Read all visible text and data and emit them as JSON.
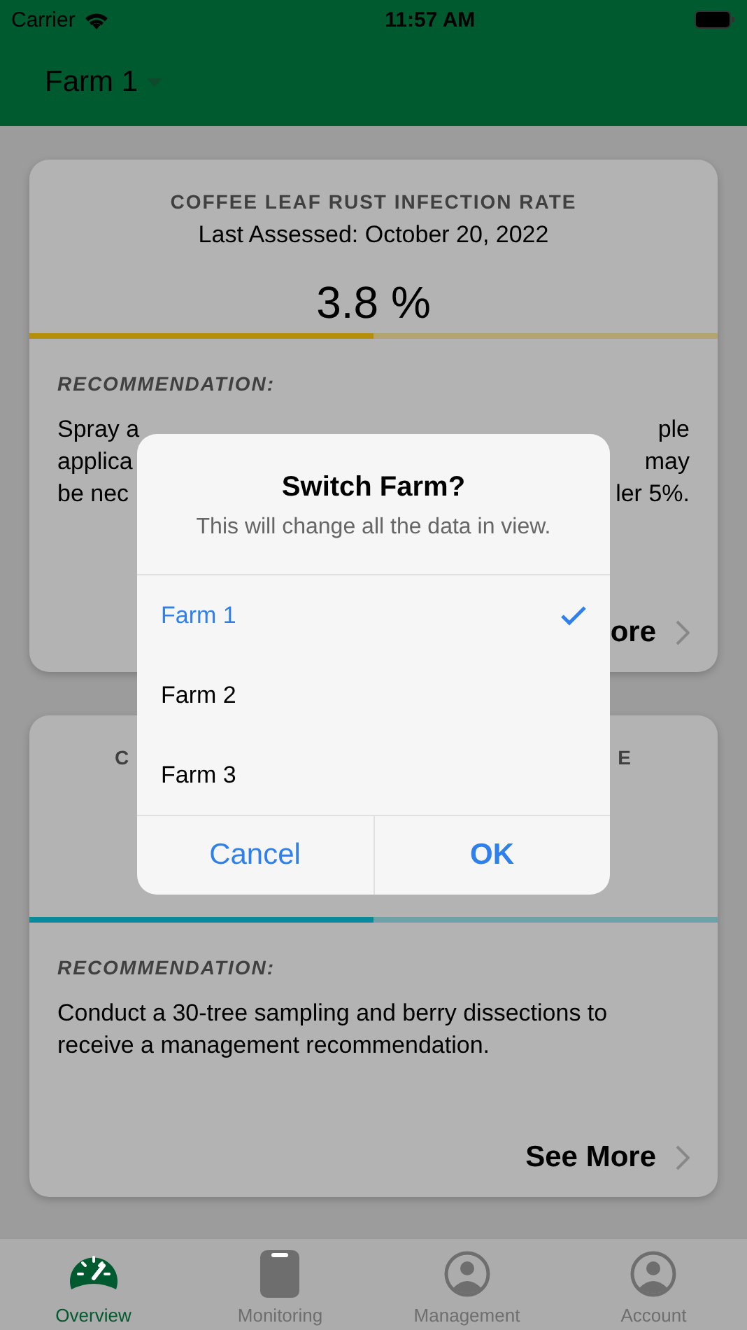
{
  "status_bar": {
    "carrier": "Carrier",
    "time": "11:57 AM"
  },
  "nav": {
    "title": "Farm 1"
  },
  "cards": [
    {
      "title_parts": [
        "COFFEE LEAF RUST INFECTION RATE"
      ],
      "subtitle": "Last Assessed: October 20, 2022",
      "value": "3.8 %",
      "level": 0.5,
      "color": "#b58e0c",
      "recommendation_label": "RECOMMENDATION:",
      "text_lines": [
        {
          "left": "Spray a",
          "right": "ple"
        },
        {
          "left": "applica",
          "right": "may"
        },
        {
          "left": "be nec",
          "right": "ler 5%."
        }
      ],
      "see_more": "ore"
    },
    {
      "title_parts": [
        "C",
        "E"
      ],
      "level": 0.5,
      "color": "#0a8a99",
      "recommendation_label": "RECOMMENDATION:",
      "text": "Conduct a 30-tree sampling and berry dissections to receive a management recommendation.",
      "see_more": "See More"
    }
  ],
  "dialog": {
    "title": "Switch Farm?",
    "message": "This will change all the data in view.",
    "options": [
      {
        "label": "Farm 1",
        "selected": true
      },
      {
        "label": "Farm 2",
        "selected": false
      },
      {
        "label": "Farm 3",
        "selected": false
      }
    ],
    "buttons": [
      {
        "label": "Cancel",
        "kind": "cancel"
      },
      {
        "label": "OK",
        "kind": "confirm"
      }
    ]
  },
  "tabs": [
    {
      "label": "Overview",
      "kind": "gauge",
      "selected": true
    },
    {
      "label": "Monitoring",
      "kind": "clipboard",
      "selected": false
    },
    {
      "label": "Management",
      "kind": "person",
      "selected": false
    },
    {
      "label": "Account",
      "kind": "person",
      "selected": false
    }
  ]
}
